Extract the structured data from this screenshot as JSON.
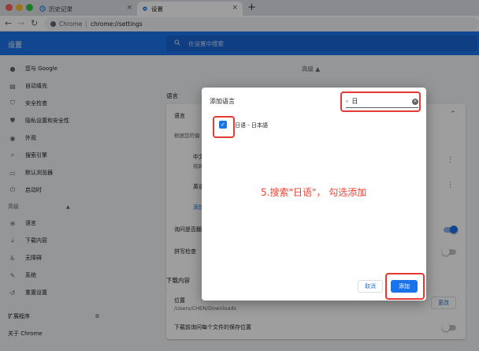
{
  "browser": {
    "tabs": [
      {
        "label": "历史记录"
      },
      {
        "label": "设置"
      }
    ],
    "omnibox": {
      "site": "Chrome",
      "url": "chrome://settings"
    }
  },
  "settings": {
    "title": "设置",
    "search_placeholder": "在设置中搜索",
    "sidebar": [
      {
        "label": "您与 Google",
        "icon": "person-icon"
      },
      {
        "label": "自动填充",
        "icon": "clipboard-icon"
      },
      {
        "label": "安全检查",
        "icon": "shield-check-icon"
      },
      {
        "label": "隐私设置和安全性",
        "icon": "shield-icon"
      },
      {
        "label": "外观",
        "icon": "palette-icon"
      },
      {
        "label": "搜索引擎",
        "icon": "search-icon"
      },
      {
        "label": "默认浏览器",
        "icon": "browser-icon"
      },
      {
        "label": "启动时",
        "icon": "power-icon"
      }
    ],
    "advanced_header": "高级",
    "advanced_items": [
      {
        "label": "语言",
        "icon": "globe-icon"
      },
      {
        "label": "下载内容",
        "icon": "download-icon"
      },
      {
        "label": "无障碍",
        "icon": "accessibility-icon"
      },
      {
        "label": "系统",
        "icon": "wrench-icon"
      },
      {
        "label": "重置设置",
        "icon": "history-icon"
      }
    ],
    "extensions": "扩展程序",
    "about": "关于 Chrome",
    "main": {
      "advanced_toggle": "高级",
      "language_section": "语言",
      "language_card_title": "语言",
      "language_order_text": "根据您的偏",
      "lang_item1_line1": "中文",
      "lang_item1_line2": "将网",
      "lang_item2": "英语",
      "add_languages_link": "添加",
      "offer_translate": "询问是否翻",
      "spellcheck": "拼写检查",
      "downloads_section": "下载内容",
      "location_label": "位置",
      "location_path": "/Users/CHEN/Downloads",
      "change_button": "更改",
      "ask_where_to_save": "下载前询问每个文件的保存位置"
    }
  },
  "dialog": {
    "title": "添加语言",
    "search_value": "日",
    "language_option": "日语 - 日本語",
    "cancel_label": "取消",
    "add_label": "添加",
    "annotation": "5.搜索\"日语\"， 勾选添加"
  },
  "colors": {
    "accent": "#1a73e8",
    "annotation_red": "#e53935"
  }
}
